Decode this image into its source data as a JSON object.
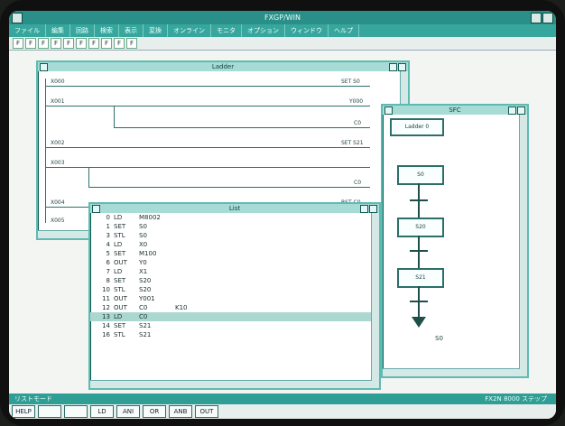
{
  "window": {
    "title": "FXGP/WIN"
  },
  "menu": [
    "ファイル",
    "編集",
    "回路",
    "検索",
    "表示",
    "変換",
    "オンライン",
    "モニタ",
    "オプション",
    "ウィンドウ",
    "ヘルプ"
  ],
  "toolbar": [
    "F",
    "F",
    "F",
    "F",
    "F",
    "F",
    "F",
    "F",
    "F",
    "F"
  ],
  "ladder": {
    "title": "Ladder",
    "left_labels": [
      "X000",
      "X001",
      "X002",
      "X003",
      "X004",
      "X005"
    ],
    "right_labels": [
      "SET S0",
      "Y000",
      "C0",
      "SET S21",
      "C0",
      "RST C0"
    ]
  },
  "sfc": {
    "title": "SFC",
    "header": "Ladder 0",
    "steps": [
      "S0",
      "S20",
      "S21"
    ],
    "end_label": "S0"
  },
  "list": {
    "title": "List",
    "rows": [
      {
        "n": "0",
        "op": "LD",
        "dev": "M8002",
        "c": ""
      },
      {
        "n": "1",
        "op": "SET",
        "dev": "S0",
        "c": ""
      },
      {
        "n": "3",
        "op": "STL",
        "dev": "S0",
        "c": ""
      },
      {
        "n": "4",
        "op": "LD",
        "dev": "X0",
        "c": ""
      },
      {
        "n": "5",
        "op": "SET",
        "dev": "M100",
        "c": ""
      },
      {
        "n": "6",
        "op": "OUT",
        "dev": "Y0",
        "c": ""
      },
      {
        "n": "7",
        "op": "LD",
        "dev": "X1",
        "c": ""
      },
      {
        "n": "8",
        "op": "SET",
        "dev": "S20",
        "c": ""
      },
      {
        "n": "10",
        "op": "STL",
        "dev": "S20",
        "c": ""
      },
      {
        "n": "11",
        "op": "OUT",
        "dev": "Y001",
        "c": ""
      },
      {
        "n": "12",
        "op": "OUT",
        "dev": "C0",
        "c": "K10"
      },
      {
        "n": "13",
        "op": "LD",
        "dev": "C0",
        "c": ""
      },
      {
        "n": "14",
        "op": "SET",
        "dev": "S21",
        "c": ""
      },
      {
        "n": "16",
        "op": "STL",
        "dev": "S21",
        "c": ""
      }
    ],
    "selected_index": 11
  },
  "status": {
    "left": "リストモード",
    "right": "FX2N 8000 ステップ"
  },
  "fkeys": [
    "HELP",
    "",
    "",
    "LD",
    "ANI",
    "OR",
    "ANB",
    "OUT"
  ]
}
